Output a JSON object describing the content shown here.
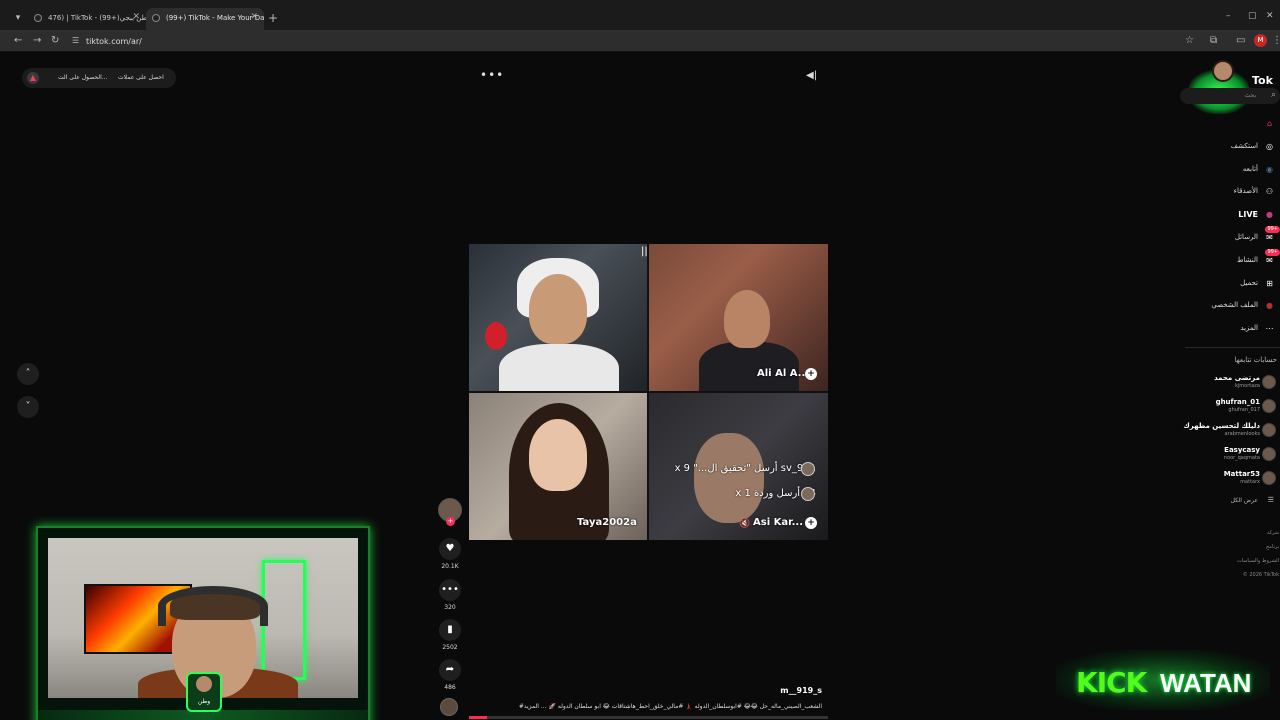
{
  "browser": {
    "tabs": [
      {
        "title": "476) | TikTok - بوطن ببجي(+99)"
      },
      {
        "title": "(99+) TikTok - Make Your Day"
      }
    ],
    "url": "tiktok.com/ar/",
    "profile_initial": "M"
  },
  "top_bar": {
    "get_coins": "احصل على عملات",
    "get_app": "الحصول على الت..."
  },
  "video": {
    "participants": [
      {
        "name": ""
      },
      {
        "name": "Ali Al A..."
      },
      {
        "name": "Taya2002a"
      },
      {
        "name": "Asi Kar..."
      }
    ],
    "gift_lines": [
      {
        "text": "911_sv  أرسل \"تحقيق ال...\"  x 9"
      },
      {
        "text": "14  أرسل وردة  x 1"
      }
    ],
    "username": "m__919_s",
    "caption": "#الشعب_الصيني_ماله_حل 😂😂 #ابوسلطان_الدوله 🗼 #مالي_خلق_احط_هاشتاقات 😂 ابو سلطان الدوله 🚀 ... المزيد",
    "progress": 0.05
  },
  "actions": {
    "likes": "20.1K",
    "comments": "320",
    "saves": "2502",
    "shares": "486"
  },
  "sidebar": {
    "brand": "Tok",
    "search_placeholder": "بحث",
    "nav": [
      {
        "label": "",
        "icon": "home-icon"
      },
      {
        "label": "استكشف",
        "icon": "compass-icon"
      },
      {
        "label": "أتابعه",
        "icon": "following-icon"
      },
      {
        "label": "الأصدقاء",
        "icon": "friends-icon"
      },
      {
        "label": "LIVE",
        "icon": "live-icon"
      },
      {
        "label": "الرسائل",
        "icon": "messages-icon",
        "badge": "99+"
      },
      {
        "label": "النشاط",
        "icon": "activity-icon",
        "badge": "99+"
      },
      {
        "label": "تحميل",
        "icon": "upload-icon"
      },
      {
        "label": "الملف الشخصي",
        "icon": "profile-icon"
      },
      {
        "label": "المزيد",
        "icon": "more-icon"
      }
    ],
    "following_title": "حسابات تتابعها",
    "following": [
      {
        "name": "مرتضى محمد",
        "handle": "kjmortaza"
      },
      {
        "name": "ghufran_01",
        "handle": "ghufran_017"
      },
      {
        "name": "دليلك لتحسين مظهرك",
        "handle": "arabmenlooks"
      },
      {
        "name": "Easycasy",
        "handle": "noor_qaqmata"
      },
      {
        "name": "Mattar53",
        "handle": "mattarx"
      }
    ],
    "see_all": "عرض الكل",
    "footer": [
      "شركة",
      "برنامج",
      "الشروط والسياسات",
      "© 2026 TikTok"
    ]
  },
  "overlay": {
    "kick_left": "KICK",
    "kick_right": "WATAN",
    "cam_badge": "وطن"
  }
}
